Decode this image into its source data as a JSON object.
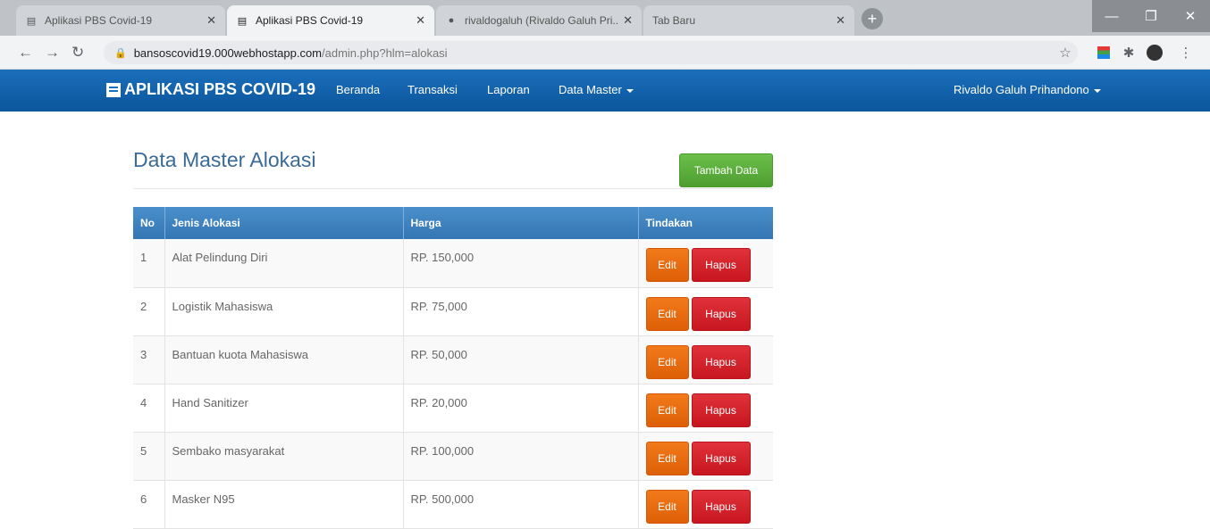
{
  "browser": {
    "tabs": [
      {
        "title": "Aplikasi PBS Covid-19",
        "active": false
      },
      {
        "title": "Aplikasi PBS Covid-19",
        "active": true
      },
      {
        "title": "rivaldogaluh (Rivaldo Galuh Pri...",
        "active": false
      },
      {
        "title": "Tab Baru",
        "active": false
      }
    ],
    "url_host": "bansoscovid19.000webhostapp.com",
    "url_path": "/admin.php?hlm=alokasi"
  },
  "navbar": {
    "brand": "APLIKASI PBS COVID-19",
    "links": [
      "Beranda",
      "Transaksi",
      "Laporan",
      "Data Master"
    ],
    "user": "Rivaldo Galuh Prihandono"
  },
  "page": {
    "title": "Data Master Alokasi",
    "add_button": "Tambah Data"
  },
  "table": {
    "headers": [
      "No",
      "Jenis Alokasi",
      "Harga",
      "Tindakan"
    ],
    "rows": [
      {
        "no": "1",
        "jenis": "Alat Pelindung Diri",
        "harga": "RP. 150,000"
      },
      {
        "no": "2",
        "jenis": "Logistik Mahasiswa",
        "harga": "RP. 75,000"
      },
      {
        "no": "3",
        "jenis": "Bantuan kuota Mahasiswa",
        "harga": "RP. 50,000"
      },
      {
        "no": "4",
        "jenis": "Hand Sanitizer",
        "harga": "RP. 20,000"
      },
      {
        "no": "5",
        "jenis": "Sembako masyarakat",
        "harga": "RP. 100,000"
      },
      {
        "no": "6",
        "jenis": "Masker N95",
        "harga": "RP. 500,000"
      }
    ],
    "edit_label": "Edit",
    "delete_label": "Hapus"
  },
  "colors": {
    "navbar": "#0f5fa8",
    "table_header": "#3d83c0",
    "add_button": "#5cae3c",
    "edit_button": "#e8690f",
    "delete_button": "#d4212a"
  }
}
